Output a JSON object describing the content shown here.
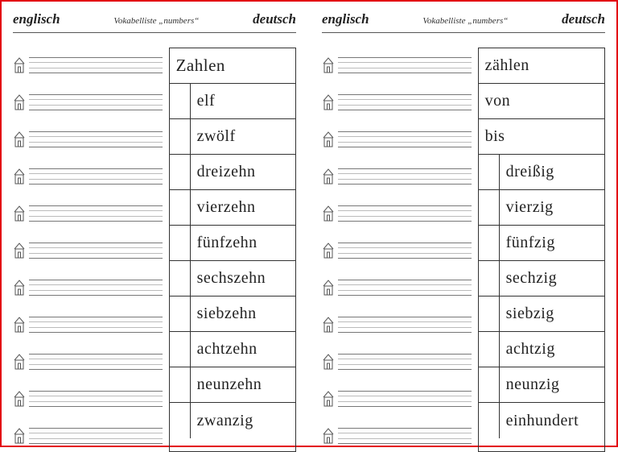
{
  "header": {
    "english_label": "englisch",
    "subtitle": "Vokabelliste „numbers“",
    "german_label": "deutsch"
  },
  "pages": [
    {
      "rows": [
        {
          "type": "title",
          "de": "Zahlen"
        },
        {
          "type": "indent",
          "de": "elf"
        },
        {
          "type": "indent",
          "de": "zwölf"
        },
        {
          "type": "indent",
          "de": "dreizehn"
        },
        {
          "type": "indent",
          "de": "vierzehn"
        },
        {
          "type": "indent",
          "de": "fünfzehn"
        },
        {
          "type": "indent",
          "de": "sechszehn"
        },
        {
          "type": "indent",
          "de": "siebzehn"
        },
        {
          "type": "indent",
          "de": "achtzehn"
        },
        {
          "type": "indent",
          "de": "neunzehn"
        },
        {
          "type": "indent",
          "de": "zwanzig"
        }
      ]
    },
    {
      "rows": [
        {
          "type": "full",
          "de": "zählen"
        },
        {
          "type": "full",
          "de": "von"
        },
        {
          "type": "full",
          "de": "bis"
        },
        {
          "type": "indent",
          "de": "dreißig"
        },
        {
          "type": "indent",
          "de": "vierzig"
        },
        {
          "type": "indent",
          "de": "fünfzig"
        },
        {
          "type": "indent",
          "de": "sechzig"
        },
        {
          "type": "indent",
          "de": "siebzig"
        },
        {
          "type": "indent",
          "de": "achtzig"
        },
        {
          "type": "indent",
          "de": "neunzig"
        },
        {
          "type": "indent",
          "de": "einhundert"
        }
      ]
    }
  ]
}
